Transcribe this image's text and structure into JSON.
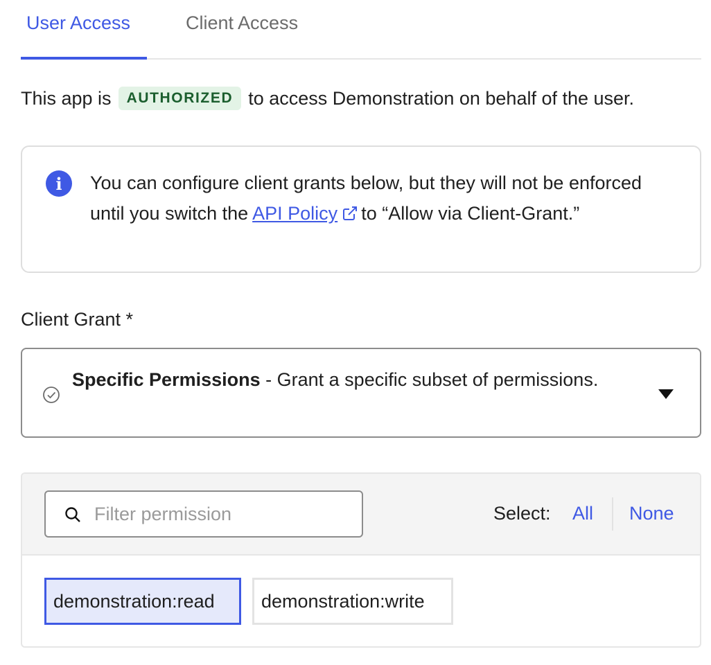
{
  "tabs": [
    {
      "label": "User Access",
      "active": true
    },
    {
      "label": "Client Access",
      "active": false
    }
  ],
  "authorization": {
    "prefix": "This app is",
    "badge": "AUTHORIZED",
    "suffix": "to access Demonstration on behalf of the user."
  },
  "info": {
    "text_before": "You can configure client grants below, but they will not be enforced until you switch the",
    "link_label": "API Policy",
    "text_after": "to “Allow via Client-Grant.”"
  },
  "client_grant": {
    "label": "Client Grant *",
    "selected_title": "Specific Permissions",
    "selected_description": "- Grant a specific subset of permissions."
  },
  "permissions": {
    "filter_placeholder": "Filter permission",
    "filter_value": "",
    "select_label": "Select:",
    "select_all": "All",
    "select_none": "None",
    "items": [
      {
        "label": "demonstration:read",
        "selected": true
      },
      {
        "label": "demonstration:write",
        "selected": false
      }
    ]
  },
  "colors": {
    "accent": "#3f59e4",
    "badge_bg": "#e3f3e6",
    "badge_text": "#1b5e2e",
    "selected_chip_bg": "#e5e9fb"
  },
  "icons": {
    "info": "info-icon",
    "external_link": "external-link-icon",
    "check": "check-circle-icon",
    "dropdown": "caret-down-icon",
    "search": "search-icon"
  }
}
